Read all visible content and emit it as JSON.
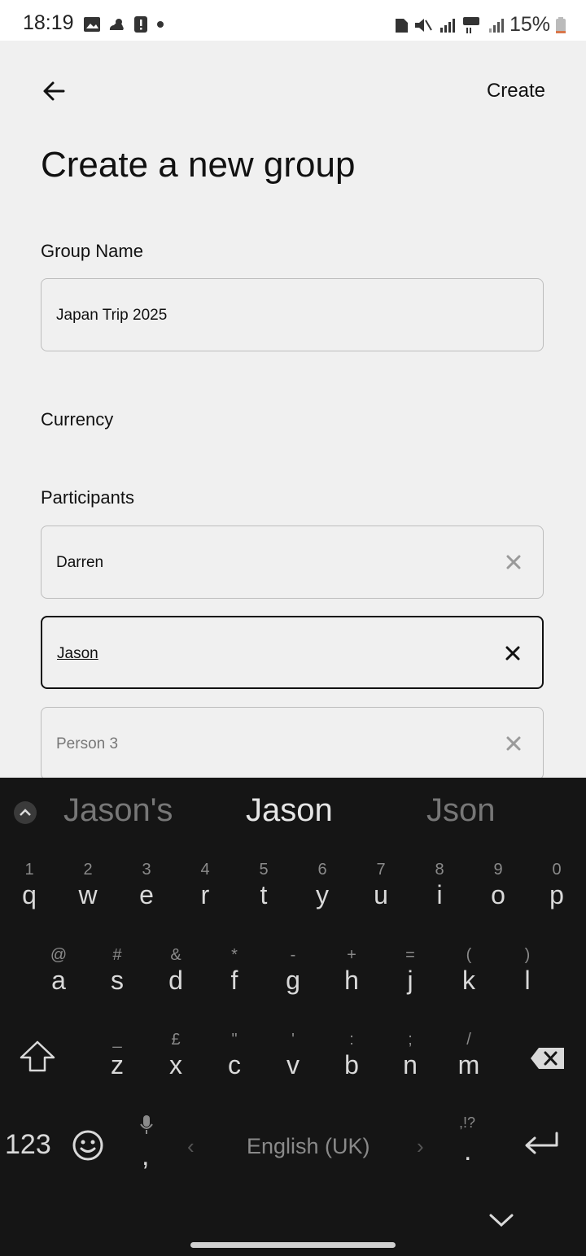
{
  "status_bar": {
    "time": "18:19",
    "battery": "15%"
  },
  "header": {
    "create_label": "Create"
  },
  "page_title": "Create a new group",
  "group_name": {
    "label": "Group Name",
    "value": "Japan Trip 2025"
  },
  "currency": {
    "label": "Currency"
  },
  "participants": {
    "label": "Participants",
    "items": [
      {
        "value": "Darren"
      },
      {
        "value": "Jason"
      },
      {
        "placeholder": "Person 3"
      }
    ]
  },
  "keyboard": {
    "suggestions": [
      "Jason's",
      "Jason",
      "Json"
    ],
    "row1": [
      {
        "sub": "1",
        "main": "q"
      },
      {
        "sub": "2",
        "main": "w"
      },
      {
        "sub": "3",
        "main": "e"
      },
      {
        "sub": "4",
        "main": "r"
      },
      {
        "sub": "5",
        "main": "t"
      },
      {
        "sub": "6",
        "main": "y"
      },
      {
        "sub": "7",
        "main": "u"
      },
      {
        "sub": "8",
        "main": "i"
      },
      {
        "sub": "9",
        "main": "o"
      },
      {
        "sub": "0",
        "main": "p"
      }
    ],
    "row2": [
      {
        "sub": "@",
        "main": "a"
      },
      {
        "sub": "#",
        "main": "s"
      },
      {
        "sub": "&",
        "main": "d"
      },
      {
        "sub": "*",
        "main": "f"
      },
      {
        "sub": "-",
        "main": "g"
      },
      {
        "sub": "+",
        "main": "h"
      },
      {
        "sub": "=",
        "main": "j"
      },
      {
        "sub": "(",
        "main": "k"
      },
      {
        "sub": ")",
        "main": "l"
      }
    ],
    "row3": [
      {
        "sub": "_",
        "main": "z"
      },
      {
        "sub": "£",
        "main": "x"
      },
      {
        "sub": "\"",
        "main": "c"
      },
      {
        "sub": "'",
        "main": "v"
      },
      {
        "sub": ":",
        "main": "b"
      },
      {
        "sub": ";",
        "main": "n"
      },
      {
        "sub": "/",
        "main": "m"
      }
    ],
    "numbers_label": "123",
    "comma": ",",
    "period": ".",
    "period_sub": ",!?",
    "space_label": "English (UK)"
  }
}
